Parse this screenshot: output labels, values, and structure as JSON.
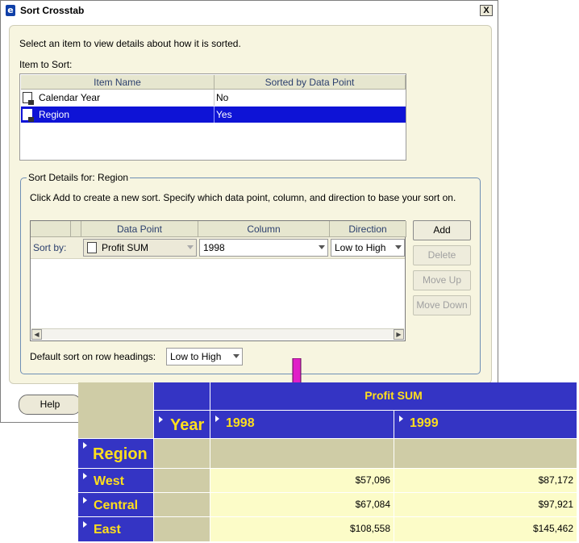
{
  "window": {
    "title": "Sort Crosstab",
    "close_label": "X",
    "app_icon": "e"
  },
  "intro_text": "Select an item to view details about how it is sorted.",
  "item_to_sort_label": "Item to Sort:",
  "items_table": {
    "headers": [
      "Item Name",
      "Sorted by Data Point"
    ],
    "rows": [
      {
        "name": "Calendar Year",
        "sorted": "No",
        "selected": false
      },
      {
        "name": "Region",
        "sorted": "Yes",
        "selected": true
      }
    ]
  },
  "sort_details": {
    "title": "Sort Details for: Region",
    "instruction": "Click Add to create a new sort. Specify which data point, column, and direction to base your sort on.",
    "grid_headers": [
      "Data Point",
      "Column",
      "Direction"
    ],
    "row_label": "Sort by:",
    "data_point": "Profit SUM",
    "column": "1998",
    "direction": "Low to High",
    "default_label": "Default sort on row headings:",
    "default_value": "Low to High"
  },
  "buttons": {
    "add": "Add",
    "delete": "Delete",
    "move_up": "Move Up",
    "move_down": "Move Down",
    "help": "Help"
  },
  "crosstab": {
    "measure": "Profit SUM",
    "column_dim": "Year",
    "row_dim": "Region",
    "columns": [
      "1998",
      "1999"
    ],
    "rows": [
      {
        "label": "West",
        "values": [
          "$57,096",
          "$87,172"
        ]
      },
      {
        "label": "Central",
        "values": [
          "$67,084",
          "$97,921"
        ]
      },
      {
        "label": "East",
        "values": [
          "$108,558",
          "$145,462"
        ]
      }
    ]
  },
  "colors": {
    "selection": "#0e13d6",
    "crosstab_header": "#3434c4",
    "crosstab_text": "#ffdf1d",
    "arrow": "#e020c8"
  }
}
